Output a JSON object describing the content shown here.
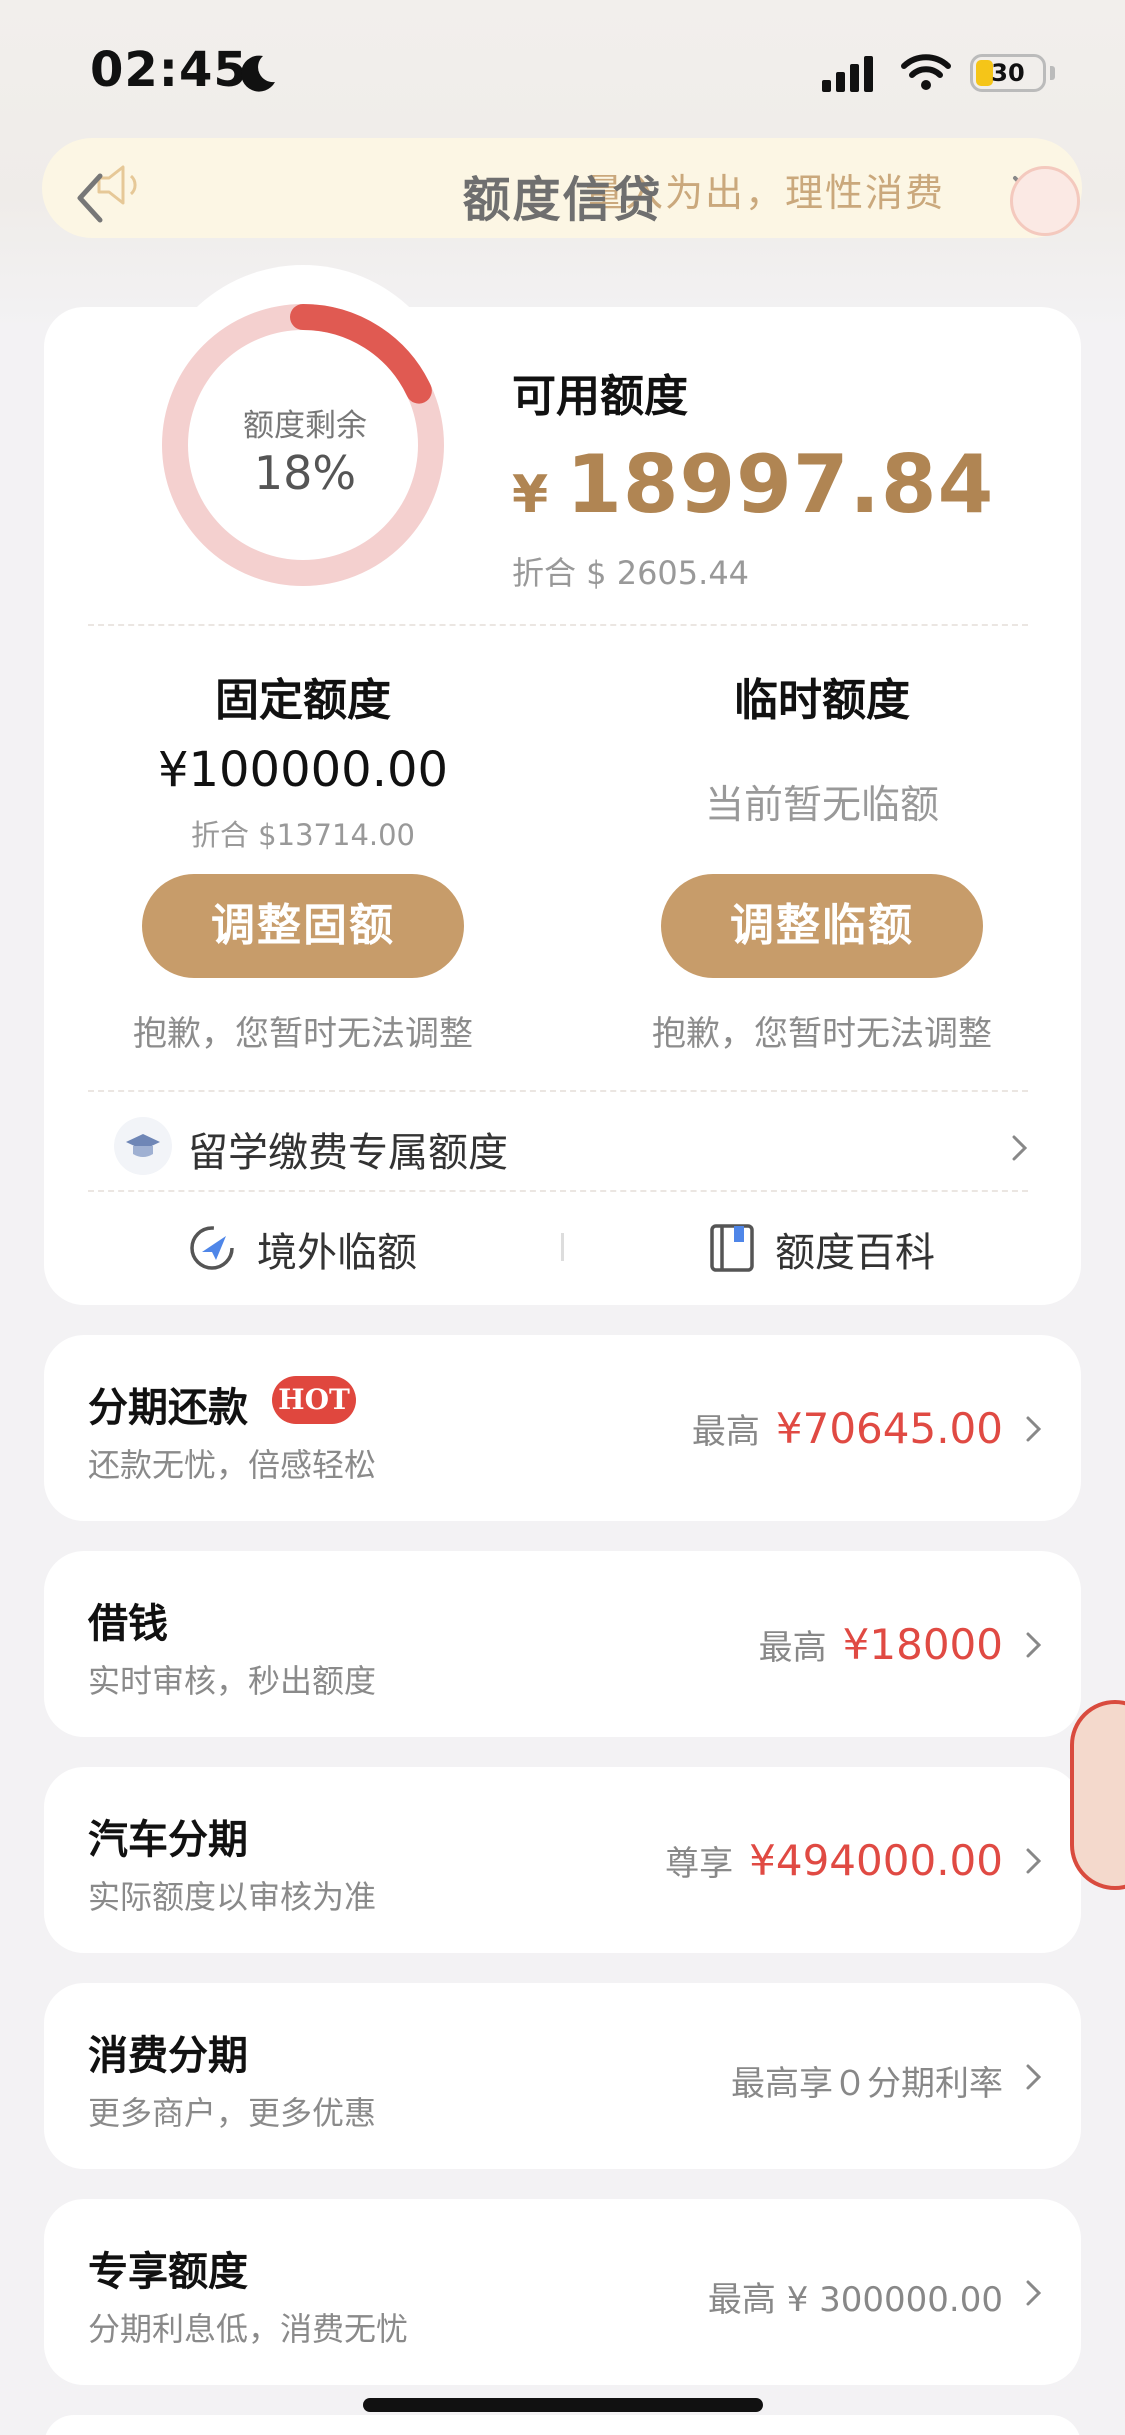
{
  "status_bar": {
    "time": "02:45",
    "battery": "30"
  },
  "header": {
    "title": "额度信贷",
    "notice": "量入为出，理性消费"
  },
  "credit": {
    "ring_label": "额度剩余",
    "ring_percent": "18%",
    "ring_fraction": 0.18,
    "available_title": "可用额度",
    "available_currency": "¥",
    "available_amount": "18997.84",
    "available_usd": "折合 $ 2605.44"
  },
  "fixed": {
    "title": "固定额度",
    "amount": "¥100000.00",
    "usd": "折合 $13714.00",
    "button": "调整固额",
    "note": "抱歉，您暂时无法调整"
  },
  "temporary": {
    "title": "临时额度",
    "status": "当前暂无临额",
    "button": "调整临额",
    "note": "抱歉，您暂时无法调整"
  },
  "study": {
    "label": "留学缴费专属额度"
  },
  "links": {
    "overseas": "境外临额",
    "wiki": "额度百科"
  },
  "products": [
    {
      "title": "分期还款",
      "badge": "HOT",
      "subtitle": "还款无忧，倍感轻松",
      "prefix": "最高",
      "value": "¥70645.00"
    },
    {
      "title": "借钱",
      "subtitle": "实时审核，秒出额度",
      "prefix": "最高",
      "value": "¥18000"
    },
    {
      "title": "汽车分期",
      "subtitle": "实际额度以审核为准",
      "prefix": "尊享",
      "value": "¥494000.00"
    },
    {
      "title": "消费分期",
      "subtitle": "更多商户，更多优惠",
      "text": "最高享０分期利率"
    },
    {
      "title": "专享额度",
      "subtitle": "分期利息低，消费无忧",
      "text": "最高 ¥ 300000.00"
    }
  ],
  "colors": {
    "accent_gold": "#c79c6a",
    "amount_gold": "#b08553",
    "red": "#e04a43",
    "ring_bg": "#f3cccb",
    "ring_fill": "#e05a52"
  }
}
